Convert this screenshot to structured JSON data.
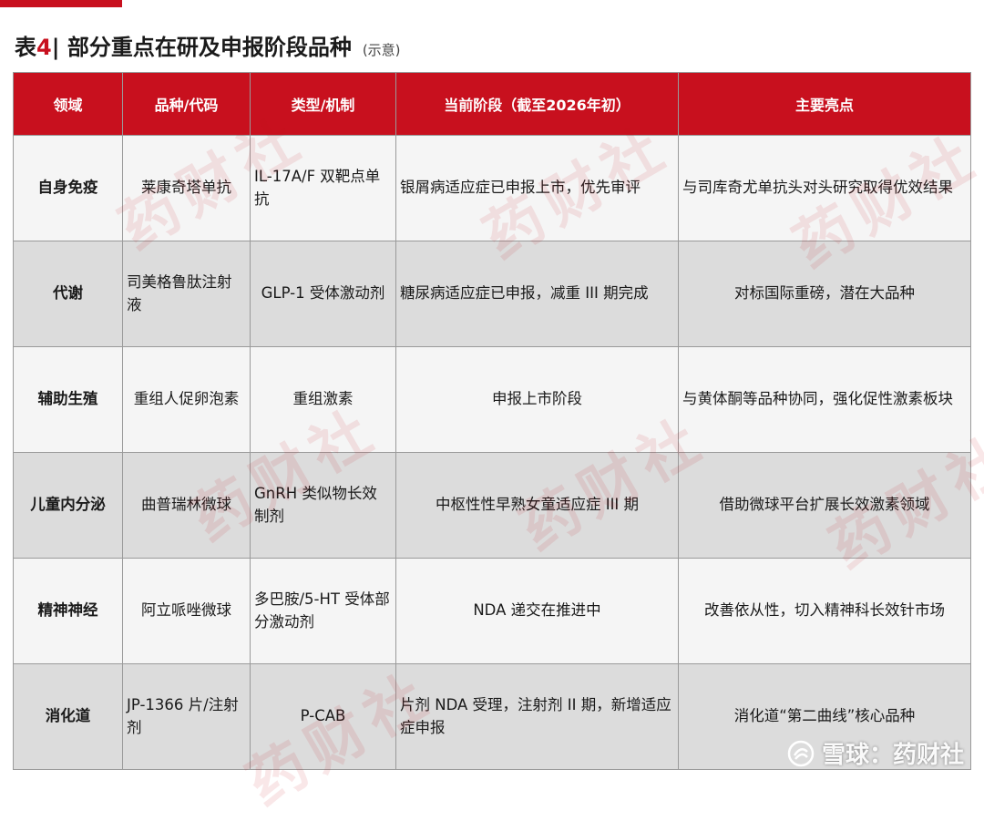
{
  "title": {
    "prefix": "表",
    "number": "4",
    "text": " | 部分重点在研及申报阶段品种",
    "note": "(示意)"
  },
  "table": {
    "headers": [
      "领域",
      "品种/代码",
      "类型/机制",
      "当前阶段（截至2026年初）",
      "主要亮点"
    ],
    "rows": [
      [
        "自身免疫",
        "莱康奇塔单抗",
        "IL-17A/F 双靶点单抗",
        "银屑病适应症已申报上市，优先审评",
        "与司库奇尤单抗头对头研究取得优效结果"
      ],
      [
        "代谢",
        "司美格鲁肽注射液",
        "GLP-1 受体激动剂",
        "糖尿病适应症已申报，减重 III 期完成",
        "对标国际重磅，潜在大品种"
      ],
      [
        "辅助生殖",
        "重组人促卵泡素",
        "重组激素",
        "申报上市阶段",
        "与黄体酮等品种协同，强化促性激素板块"
      ],
      [
        "儿童内分泌",
        "曲普瑞林微球",
        "GnRH 类似物长效制剂",
        "中枢性性早熟女童适应症 III 期",
        "借助微球平台扩展长效激素领域"
      ],
      [
        "精神神经",
        "阿立哌唑微球",
        "多巴胺/5-HT 受体部分激动剂",
        "NDA 递交在推进中",
        "改善依从性，切入精神科长效针市场"
      ],
      [
        "消化道",
        "JP-1366 片/注射剂",
        "P-CAB",
        "片剂 NDA 受理，注射剂 II 期，新增适应症申报",
        "消化道“第二曲线”核心品种"
      ]
    ]
  },
  "watermark": {
    "text": "药财社"
  },
  "logo": {
    "text": "雪球：药财社",
    "icon": "snowball-logo-icon"
  },
  "colors": {
    "accent": "#c8101e",
    "row_light": "#f5f5f5",
    "row_dark": "#dcdcdc"
  }
}
